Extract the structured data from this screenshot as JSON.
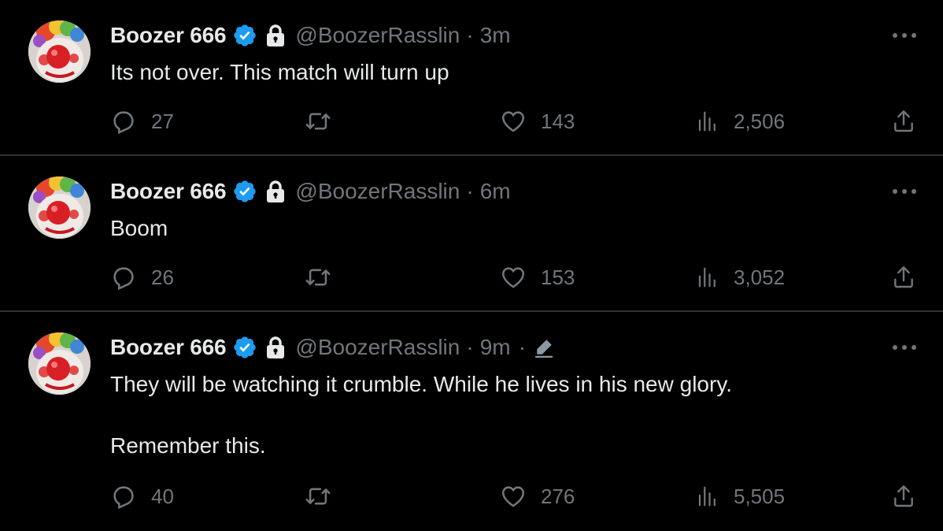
{
  "colors": {
    "background": "#000000",
    "divider": "#2f3336",
    "primary_text": "#e7e9ea",
    "secondary_text": "#71767b",
    "verified_badge": "#1d9bf0"
  },
  "tweets": [
    {
      "display_name": "Boozer 666",
      "handle": "@BoozerRasslin",
      "separator": "·",
      "time": "3m",
      "verified": true,
      "protected": true,
      "edited": false,
      "text": "Its not over. This match will turn up",
      "replies": "27",
      "retweets": "",
      "likes": "143",
      "views": "2,506"
    },
    {
      "display_name": "Boozer 666",
      "handle": "@BoozerRasslin",
      "separator": "·",
      "time": "6m",
      "verified": true,
      "protected": true,
      "edited": false,
      "text": "Boom",
      "replies": "26",
      "retweets": "",
      "likes": "153",
      "views": "3,052"
    },
    {
      "display_name": "Boozer 666",
      "handle": "@BoozerRasslin",
      "separator": "·",
      "time": "9m",
      "edit_separator": "·",
      "verified": true,
      "protected": true,
      "edited": true,
      "text": "They will be watching it crumble. While he lives in his new glory.\n\nRemember this.",
      "replies": "40",
      "retweets": "",
      "likes": "276",
      "views": "5,505"
    }
  ],
  "icons": {
    "avatar": "clown-avatar",
    "verified": "verified-badge-icon",
    "protected": "lock-icon",
    "edit": "pencil-edit-icon",
    "more": "more-horizontal-icon",
    "reply": "reply-icon",
    "retweet": "retweet-icon",
    "like": "heart-icon",
    "views": "views-bar-chart-icon",
    "share": "share-upload-icon"
  }
}
